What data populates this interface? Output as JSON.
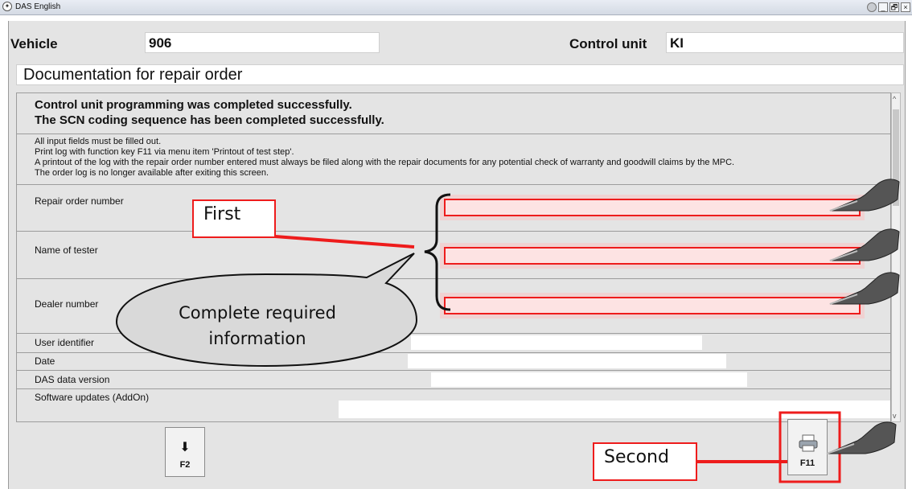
{
  "window": {
    "title": "DAS English",
    "buttons": [
      "_",
      "🗗",
      "×"
    ]
  },
  "header": {
    "vehicle_label": "Vehicle",
    "vehicle_value": "906",
    "control_unit_label": "Control unit",
    "control_unit_value": "KI",
    "document_title": "Documentation for repair order"
  },
  "messages": [
    "Control unit programming was completed successfully.",
    "The SCN coding sequence has been completed successfully."
  ],
  "instructions": [
    "All input fields must be filled out.",
    "Print log with function key F11 via menu item 'Printout of test step'.",
    "A printout of the log with the repair order number entered must always be filed along with the repair documents for any potential check of warranty and goodwill claims by the MPC.",
    "The order log is no longer available after exiting this screen."
  ],
  "fields": {
    "repair_order_number": {
      "label": "Repair order number",
      "value": ""
    },
    "name_of_tester": {
      "label": "Name of tester",
      "value": ""
    },
    "dealer_number": {
      "label": "Dealer number",
      "value": ""
    },
    "user_identifier": {
      "label": "User identifier",
      "value": ""
    },
    "date": {
      "label": "Date",
      "value": ""
    },
    "das_data_version": {
      "label": "DAS data version",
      "value": ""
    },
    "software_updates": {
      "label": "Software updates (AddOn)",
      "value": ""
    }
  },
  "function_keys": {
    "f2": {
      "label": "F2",
      "icon": "down-arrow-icon"
    },
    "f11": {
      "label": "F11",
      "icon": "printer-icon"
    }
  },
  "annotations": {
    "first": "First",
    "second": "Second",
    "cloud_line1": "Complete required",
    "cloud_line2": "information"
  },
  "colors": {
    "highlight_red": "#ee1c1c",
    "field_tint": "#fde3e3",
    "cloud_fill": "#d9d9d9"
  }
}
